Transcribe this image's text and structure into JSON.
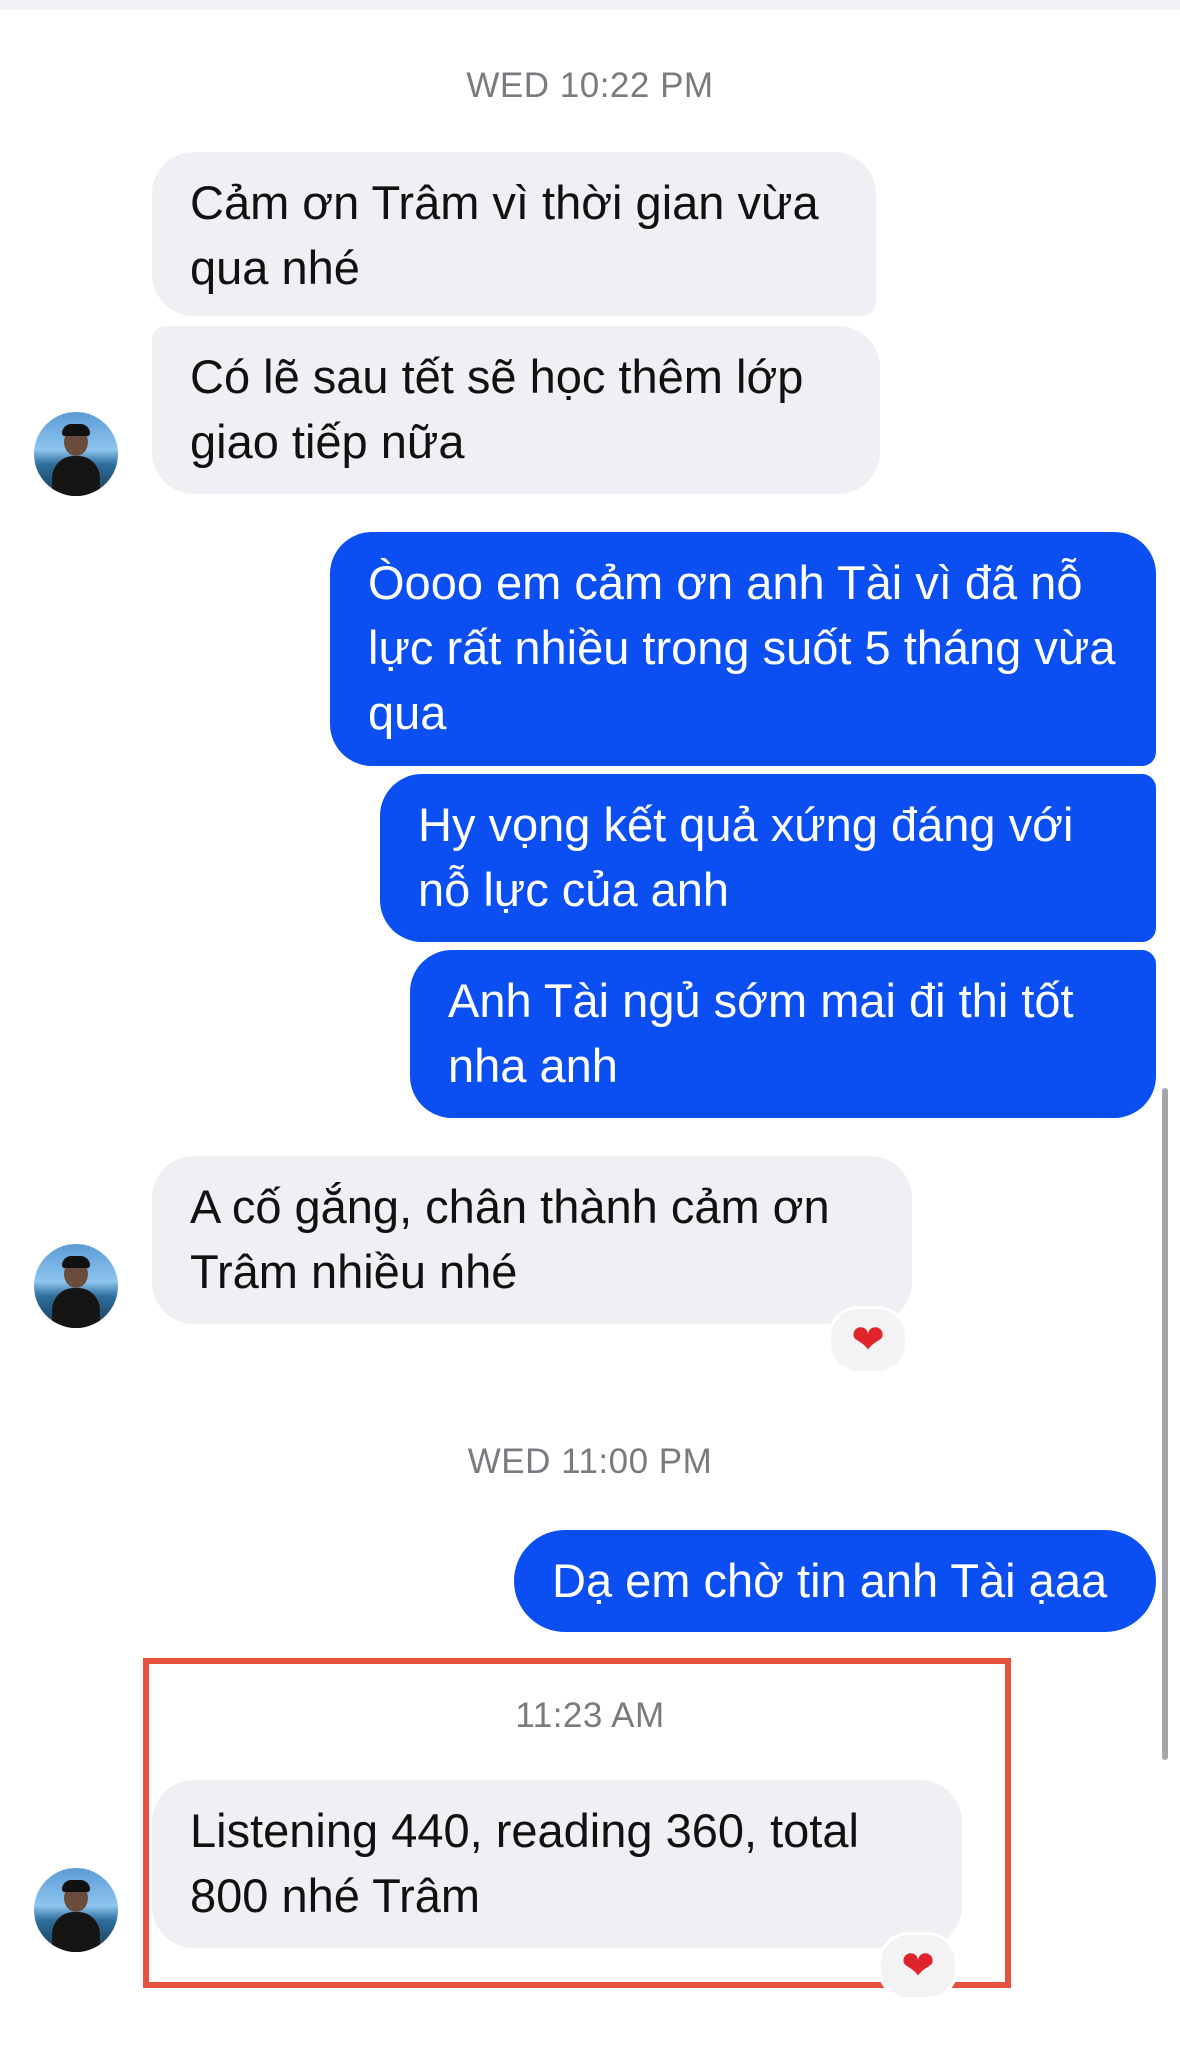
{
  "timestamps": {
    "first": "WED 10:22 PM",
    "second": "WED 11:00 PM",
    "third": "11:23 AM"
  },
  "messages": [
    {
      "from": "contact",
      "text": "Cảm ơn Trâm vì thời gian vừa qua nhé"
    },
    {
      "from": "contact",
      "text": "Có lẽ sau tết sẽ học thêm lớp giao tiếp nữa"
    },
    {
      "from": "me",
      "text": "Òooo em cảm ơn anh Tài vì đã nỗ lực rất nhiều trong suốt 5 tháng vừa qua"
    },
    {
      "from": "me",
      "text": "Hy vọng kết quả xứng đáng với nỗ lực của anh"
    },
    {
      "from": "me",
      "text": "Anh Tài ngủ sớm mai đi thi tốt nha anh"
    },
    {
      "from": "contact",
      "text": "A cố gắng, chân thành cảm ơn Trâm nhiều nhé",
      "reaction": "❤"
    },
    {
      "from": "me",
      "text": "Dạ em chờ tin anh Tài ạaa"
    },
    {
      "from": "contact",
      "text": "Listening 440, reading 360, total 800 nhé Trâm",
      "reaction": "❤"
    }
  ],
  "colors": {
    "outgoing_bubble": "#0b4ff2",
    "incoming_bubble": "#efeff4",
    "highlight_box": "#e6503c",
    "reaction_heart": "#e0242c"
  },
  "icons": {
    "avatar": "contact-avatar",
    "reaction": "heart-reaction-icon"
  }
}
